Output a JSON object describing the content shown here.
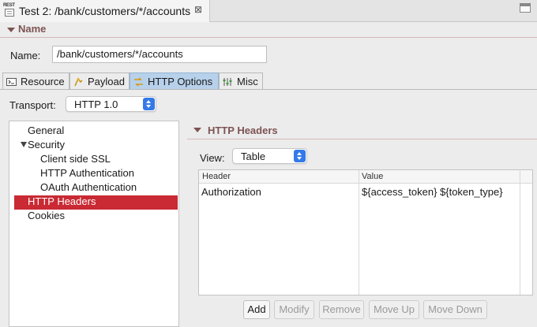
{
  "editor_tab": {
    "icon": "rest-document-icon",
    "icon_text": "REST",
    "title": "Test 2: /bank/customers/*/accounts",
    "close_glyph": "⊠"
  },
  "name_section": {
    "title": "Name",
    "name_label": "Name:",
    "name_value": "/bank/customers/*/accounts"
  },
  "tabs": [
    {
      "label": "Resource",
      "icon": "resource-icon",
      "active": false
    },
    {
      "label": "Payload",
      "icon": "payload-icon",
      "active": false
    },
    {
      "label": "HTTP Options",
      "icon": "http-options-icon",
      "active": true
    },
    {
      "label": "Misc",
      "icon": "misc-icon",
      "active": false
    }
  ],
  "transport": {
    "label": "Transport:",
    "selected": "HTTP 1.0"
  },
  "tree": {
    "items": [
      {
        "label": "General",
        "level": 0,
        "selected": false
      },
      {
        "label": "Security",
        "level": 0,
        "expanded": true,
        "selected": false
      },
      {
        "label": "Client side SSL",
        "level": 1,
        "selected": false
      },
      {
        "label": "HTTP Authentication",
        "level": 1,
        "selected": false
      },
      {
        "label": "OAuth Authentication",
        "level": 1,
        "selected": false
      },
      {
        "label": "HTTP Headers",
        "level": 0,
        "selected": true
      },
      {
        "label": "Cookies",
        "level": 0,
        "selected": false
      }
    ]
  },
  "headers_section": {
    "title": "HTTP Headers",
    "view_label": "View:",
    "view_selected": "Table",
    "columns": [
      "Header",
      "Value"
    ],
    "rows": [
      {
        "header": "Authorization",
        "value": "${access_token} ${token_type}"
      }
    ]
  },
  "buttons": {
    "add": "Add",
    "modify": "Modify",
    "remove": "Remove",
    "move_up": "Move Up",
    "move_down": "Move Down"
  },
  "colors": {
    "section_title": "#7d5353",
    "selection": "#c92a33",
    "active_tab": "#b7d1eb",
    "combo_accent": "#3479e8"
  }
}
